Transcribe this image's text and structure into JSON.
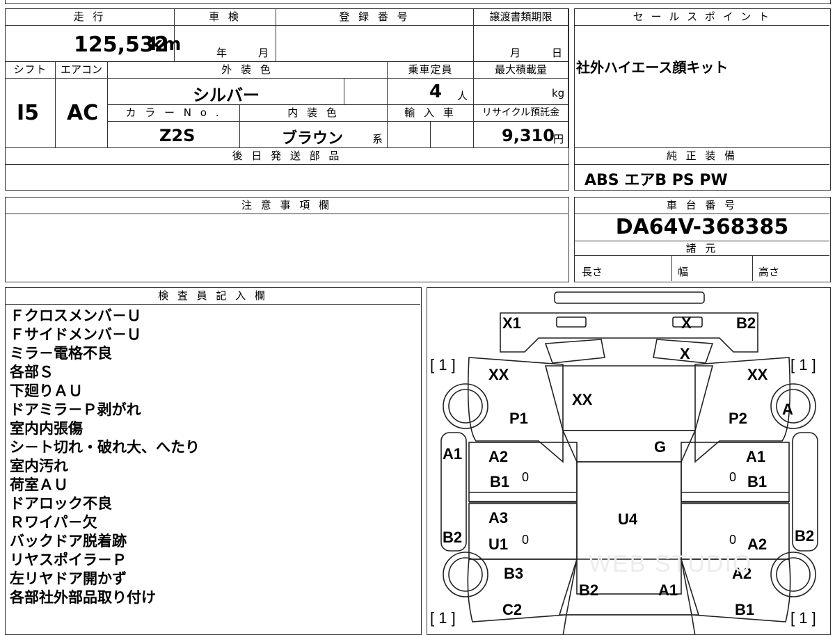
{
  "top_sheet": {
    "mileage": {
      "label": "走 行",
      "value": "125,532",
      "unit": "km"
    },
    "inspection": {
      "label": "車 検",
      "year": "年",
      "month": "月"
    },
    "registration": {
      "label": "登 録 番 号",
      "value": ""
    },
    "transfer_deadline": {
      "label": "譲渡書類期限",
      "month": "月",
      "day": "日"
    },
    "sales_point": {
      "label": "セ ー ル ス ポ イ ン ト",
      "text": "社外ハイエース顔キット"
    },
    "shift": {
      "label": "シフト",
      "value": "I5"
    },
    "aircon": {
      "label": "エアコン",
      "value": "AC"
    },
    "exterior_color": {
      "label": "外 装 色",
      "value": "シルバー"
    },
    "capacity": {
      "label": "乗車定員",
      "value": "4",
      "unit": "人"
    },
    "max_load": {
      "label": "最大積載量",
      "unit": "kg"
    },
    "color_no": {
      "label": "カ ラ ー N o .",
      "value": "Z2S"
    },
    "interior_color": {
      "label": "内 装 色",
      "value": "ブラウン",
      "suffix": "系"
    },
    "import": {
      "label": "輸 入 車"
    },
    "recycle_fee": {
      "label": "リサイクル預託金",
      "value": "9,310",
      "unit": "円"
    },
    "later_parts": {
      "label": "後 日 発 送 部 品",
      "value": ""
    },
    "genuine_equipment": {
      "label": "純 正 装 備",
      "value": "ABS エアB PS PW"
    },
    "notes": {
      "label": "注 意 事 項 欄",
      "value": ""
    },
    "chassis_number": {
      "label": "車 台 番 号",
      "value": "DA64V-368385"
    },
    "specs": {
      "label": "諸 元",
      "length": "長さ",
      "width": "幅",
      "height": "高さ"
    }
  },
  "inspector": {
    "label": "検 査 員 記 入 欄",
    "lines": [
      "Ｆクロスメンバ－Ｕ",
      "Ｆサイドメンバ－Ｕ",
      "ミラ－電格不良",
      "各部Ｓ",
      "下廻りＡＵ",
      "ドアミラ－Ｐ剥がれ",
      "室内内張傷",
      "シ－ト切れ・破れ大、へたり",
      "室内汚れ",
      "荷室ＡＵ",
      "ドアロック不良",
      "Ｒワイパ－欠",
      "バックドア脱着跡",
      "リヤスポイラ－Ｐ",
      "左リヤドア開かず",
      "各部社外部品取り付け"
    ]
  },
  "diagram": {
    "marks": {
      "front_left": "X1",
      "front_mid": "X",
      "front_right": "B2",
      "grille": "X",
      "bracket_left": "[ 1 ]",
      "bracket_right": "[ 1 ]",
      "hood_left": "XX",
      "hood_right": "XX",
      "hood": "XX",
      "fender_left": "P1",
      "fender_right": "P2",
      "wheel_fr": "A",
      "pillar_left": "A1",
      "roof": "G",
      "door_fl_a": "A2",
      "door_fl_b": "B1",
      "door_fl_z": "0",
      "door_fr_a": "A1",
      "door_fr_b": "B1",
      "door_fr_z": "0",
      "roof_center": "U4",
      "door_rl_a": "A3",
      "door_rl_b": "U1",
      "door_rl_z": "0",
      "door_rr_a": "A2",
      "door_rr_z": "0",
      "side_rl": "B2",
      "side_rr": "B2",
      "qtr_left": "B3",
      "qtr_right": "A2",
      "rear_left": "B2",
      "rear_right": "A1",
      "bumper_left": "C2",
      "bumper_right": "B1",
      "bracket_rl": "[ 1 ]",
      "bracket_rr": "[ 1 ]"
    },
    "watermark": "WEB STUDIO"
  }
}
